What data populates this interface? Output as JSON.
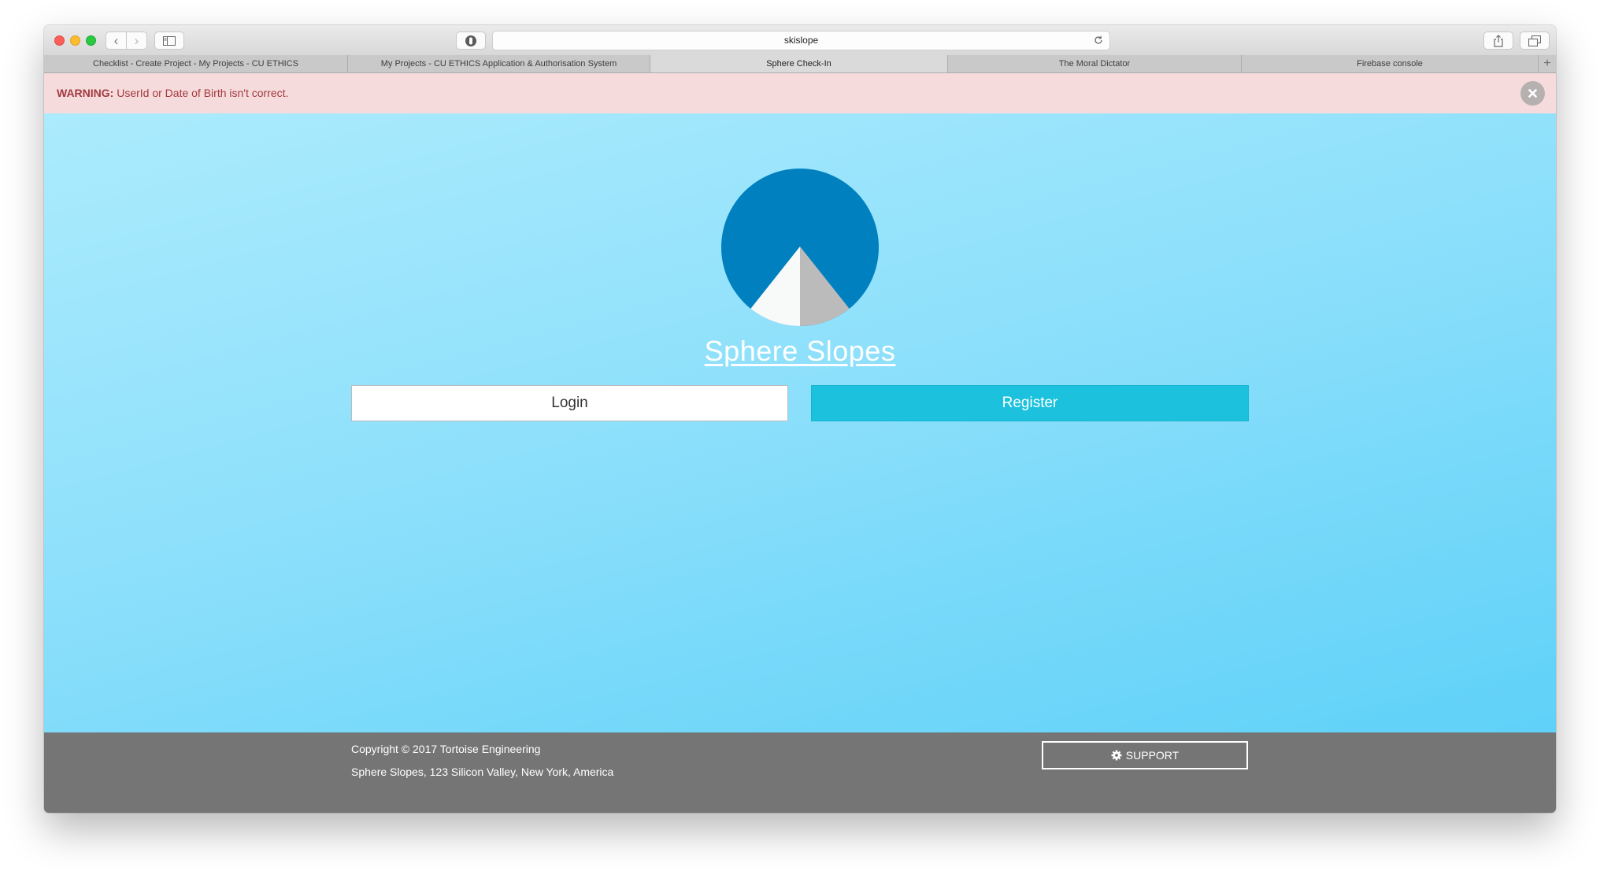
{
  "browser": {
    "address": "skislope",
    "nav": {
      "back_icon": "‹",
      "forward_icon": "›"
    },
    "new_tab_icon": "+",
    "tabs": [
      {
        "label": "Checklist - Create Project - My Projects - CU ETHICS",
        "active": false
      },
      {
        "label": "My Projects - CU ETHICS Application & Authorisation System",
        "active": false
      },
      {
        "label": "Sphere Check-In",
        "active": true
      },
      {
        "label": "The Moral Dictator",
        "active": false
      },
      {
        "label": "Firebase console",
        "active": false
      }
    ]
  },
  "alert": {
    "strong": "WARNING:",
    "message": "UserId or Date of Birth isn't correct."
  },
  "brand": {
    "title": "Sphere Slopes"
  },
  "actions": {
    "login": "Login",
    "register": "Register"
  },
  "footer": {
    "copyright": "Copyright © 2017 Tortoise Engineering",
    "address": "Sphere Slopes, 123 Silicon Valley, New York, America",
    "support": "SUPPORT"
  },
  "colors": {
    "logo_circle": "#0080bf",
    "logo_left_face": "#f8f9f9",
    "logo_right_face": "#bbbbbb",
    "register_bg": "#1cc2dd",
    "alert_bg": "#f6dbdc",
    "alert_text": "#a23a3f",
    "footer_bg": "#757575"
  }
}
